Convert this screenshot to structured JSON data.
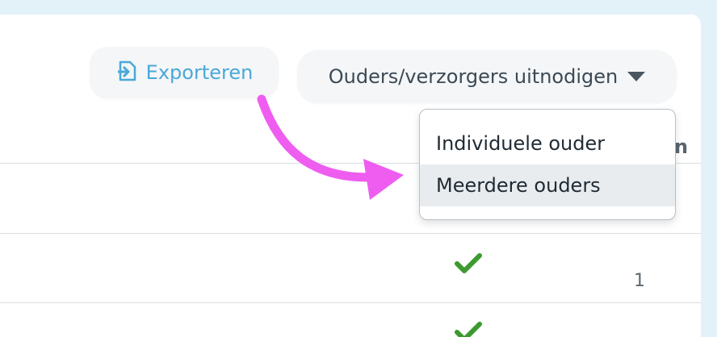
{
  "toolbar": {
    "export_label": "Exporteren",
    "invite_label": "Ouders/verzorgers uitnodigen"
  },
  "dropdown": {
    "items": [
      {
        "label": "Individuele ouder"
      },
      {
        "label": "Meerdere ouders"
      }
    ]
  },
  "table": {
    "partial_header": "n",
    "rows": [
      {
        "status": "check",
        "count": "1"
      }
    ]
  },
  "colors": {
    "export_accent": "#4aa8d8",
    "check_green": "#3c9a2e",
    "annotation_arrow": "#ee5df0"
  }
}
